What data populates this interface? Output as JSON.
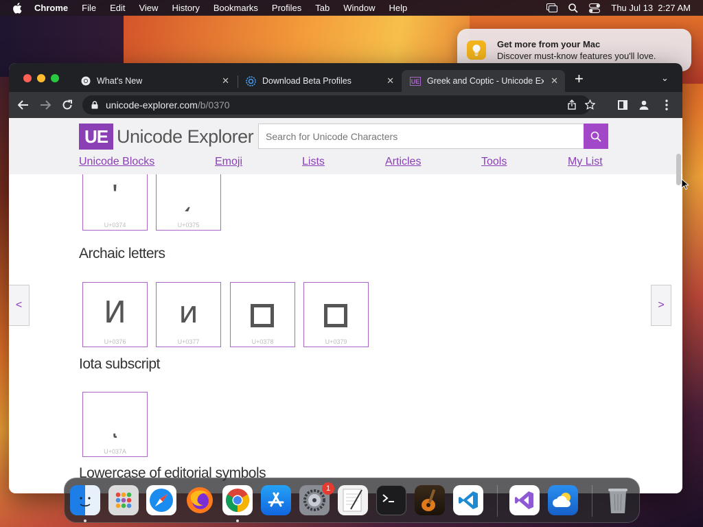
{
  "menubar": {
    "items": [
      "Chrome",
      "File",
      "Edit",
      "View",
      "History",
      "Bookmarks",
      "Profiles",
      "Tab",
      "Window",
      "Help"
    ],
    "datetime": "Thu Jul 13  2:27 AM"
  },
  "notification": {
    "title": "Get more from your Mac",
    "body": "Discover must-know features you'll love."
  },
  "browser": {
    "tabs": [
      {
        "title": "What's New",
        "icon": "chrome-icon"
      },
      {
        "title": "Download Beta Profiles",
        "icon": "gear-icon"
      },
      {
        "title": "Greek and Coptic - Unicode Ex",
        "icon": "unicode-explorer-icon"
      }
    ],
    "address": {
      "host": "unicode-explorer.com",
      "path": "/b/0370"
    }
  },
  "site": {
    "logo_mark": "UE",
    "logo_text": "Unicode Explorer",
    "search_placeholder": "Search for Unicode Characters",
    "nav": [
      "Unicode Blocks",
      "Emoji",
      "Lists",
      "Articles",
      "Tools",
      "My List"
    ],
    "prev": "<",
    "next": ">"
  },
  "sections": {
    "top_cells": [
      {
        "glyph": "ʹ",
        "code": "U+0374"
      },
      {
        "glyph": "͵",
        "code": "U+0375"
      }
    ],
    "archaic": {
      "title": "Archaic letters",
      "cells": [
        {
          "glyph": "Ͷ",
          "code": "U+0376"
        },
        {
          "glyph": "ͷ",
          "code": "U+0377"
        },
        {
          "glyph": "",
          "code": "U+0378"
        },
        {
          "glyph": "",
          "code": "U+0379"
        }
      ]
    },
    "iota": {
      "title": "Iota subscript",
      "cells": [
        {
          "glyph": "ͺ",
          "code": "U+037A"
        }
      ]
    },
    "next_title": "Lowercase of editorial symbols"
  },
  "dock": {
    "apps": [
      "Finder",
      "Launchpad",
      "Safari",
      "Firefox",
      "Google Chrome",
      "App Store",
      "System Settings",
      "TextEdit",
      "Terminal",
      "GarageBand",
      "Visual Studio Code",
      "Visual Studio",
      "Weather",
      "Trash"
    ],
    "settings_badge": "1"
  },
  "colors": {
    "accent": "#8a3fb5",
    "search_button": "#a347c9",
    "chrome_dark": "#202124",
    "toolbar": "#35363a"
  }
}
